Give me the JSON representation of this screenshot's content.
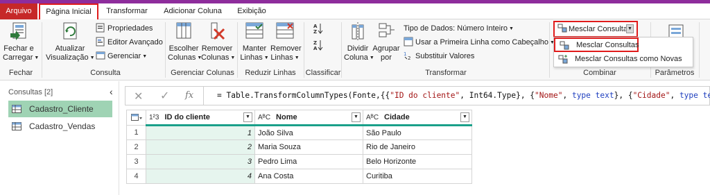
{
  "menu_tabs": {
    "file": "Arquivo",
    "home": "Página Inicial",
    "transform": "Transformar",
    "add_column": "Adicionar Coluna",
    "view": "Exibição"
  },
  "ribbon": {
    "fechar": {
      "button": "Fechar e\nCarregar",
      "line1": "Fechar e",
      "line2": "Carregar",
      "group": "Fechar"
    },
    "consulta": {
      "atualizar_line1": "Atualizar",
      "atualizar_line2": "Visualização",
      "propriedades": "Propriedades",
      "editor": "Editor Avançado",
      "gerenciar": "Gerenciar",
      "group": "Consulta"
    },
    "gerenciar_colunas": {
      "escolher_line1": "Escolher",
      "escolher_line2": "Colunas",
      "remover_line1": "Remover",
      "remover_line2": "Colunas",
      "group": "Gerenciar Colunas"
    },
    "reduzir_linhas": {
      "manter_line1": "Manter",
      "manter_line2": "Linhas",
      "remover_line1": "Remover",
      "remover_line2": "Linhas",
      "group": "Reduzir Linhas"
    },
    "classificar": {
      "group": "Classificar"
    },
    "transformar": {
      "dividir_line1": "Dividir",
      "dividir_line2": "Coluna",
      "agrupar_line1": "Agrupar",
      "agrupar_line2": "por",
      "tipo_dados": "Tipo de Dados: Número Inteiro",
      "primeira_linha": "Usar a Primeira Linha como Cabeçalho",
      "substituir": "Substituir Valores",
      "group": "Transformar"
    },
    "combinar": {
      "mesclar": "Mesclar Consultas",
      "group": "Combinar"
    },
    "parametros": {
      "group": "Parâmetros"
    }
  },
  "dropdown_menu": {
    "item1": "Mesclar Consultas",
    "item2": "Mesclar Consultas como Novas"
  },
  "queries_panel": {
    "title": "Consultas [2]",
    "items": [
      "Cadastro_Cliente",
      "Cadastro_Vendas"
    ]
  },
  "formula_bar": {
    "fx": "fx",
    "formula": "= Table.TransformColumnTypes(Fonte,{{\"ID do cliente\", Int64.Type}, {\"Nome\", type text}, {\"Cidade\", type text}})"
  },
  "grid": {
    "columns": [
      {
        "type_icon": "1²3",
        "name": "ID do cliente"
      },
      {
        "type_icon": "AᴮC",
        "name": "Nome"
      },
      {
        "type_icon": "AᴮC",
        "name": "Cidade"
      }
    ],
    "rows": [
      {
        "n": "1",
        "id": "1",
        "nome": "João Silva",
        "cidade": "São Paulo"
      },
      {
        "n": "2",
        "id": "2",
        "nome": "Maria Souza",
        "cidade": "Rio de Janeiro"
      },
      {
        "n": "3",
        "id": "3",
        "nome": "Pedro Lima",
        "cidade": "Belo Horizonte"
      },
      {
        "n": "4",
        "id": "4",
        "nome": "Ana Costa",
        "cidade": "Curitiba"
      }
    ]
  },
  "colors": {
    "file_tab": "#c62828",
    "highlight_border": "#e01b1b",
    "selected_query": "#9fd3b4",
    "column_accent": "#1aa08a",
    "top_strip": "#8e2d9c"
  }
}
